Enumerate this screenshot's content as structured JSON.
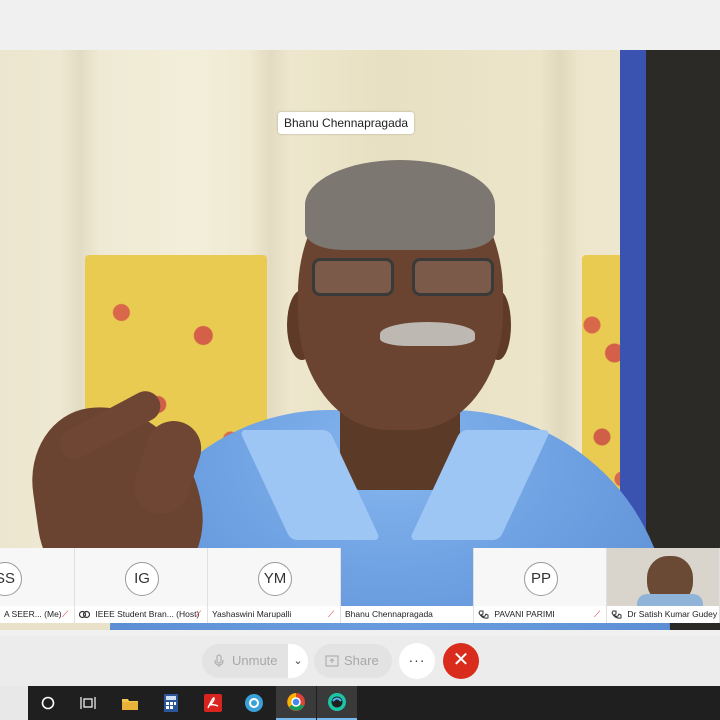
{
  "main_video": {
    "speaker_name": "Bhanu Chennapragada"
  },
  "participants": [
    {
      "initials": "SS",
      "name": "A SEER... (Me)",
      "muted": true
    },
    {
      "initials": "IG",
      "name": "IEEE Student Bran... (Host)",
      "muted": true
    },
    {
      "initials": "YM",
      "name": "Yashaswini Marupalli",
      "muted": true
    },
    {
      "initials": "",
      "name": "Bhanu Chennapragada",
      "muted": false
    },
    {
      "initials": "PP",
      "name": "PAVANI PARIMI",
      "muted": true
    },
    {
      "initials": "",
      "name": "Dr Satish Kumar Gudey",
      "muted": false
    }
  ],
  "controls": {
    "unmute_label": "Unmute",
    "share_label": "Share",
    "more_label": "···",
    "end_label": "✕"
  },
  "taskbar": {
    "icons": [
      "cortana-icon",
      "task-view-icon",
      "file-explorer-icon",
      "calculator-icon",
      "acrobat-reader-icon",
      "browser-icon",
      "chrome-icon",
      "webex-icon"
    ]
  }
}
